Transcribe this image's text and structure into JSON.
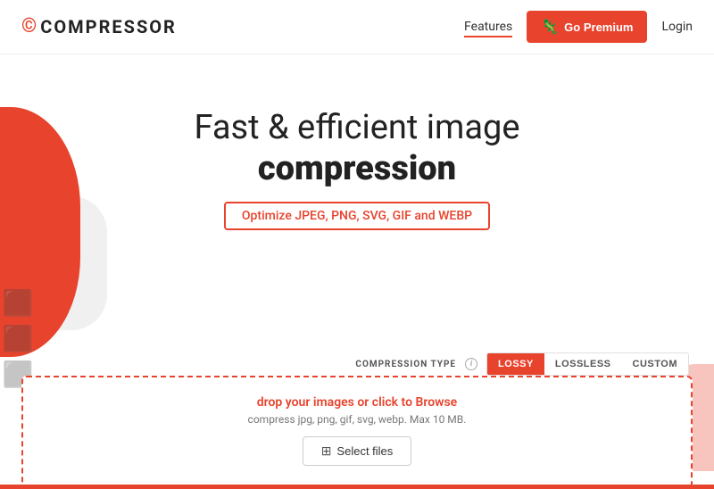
{
  "header": {
    "logo_icon": "©",
    "logo_text_before": "",
    "logo_text": "COMPRESSOR",
    "nav_features_label": "Features",
    "nav_premium_label": "Go Premium",
    "nav_login_label": "Login"
  },
  "hero": {
    "title_line1": "Fast & efficient image",
    "title_line2": "compression",
    "subtitle": "Optimize JPEG, PNG, SVG, GIF and WEBP"
  },
  "compression": {
    "label": "COMPRESSION TYPE",
    "info": "i",
    "tabs": [
      {
        "label": "LOSSY",
        "active": true
      },
      {
        "label": "LOSSLESS",
        "active": false
      },
      {
        "label": "CUSTOM",
        "active": false
      }
    ]
  },
  "dropzone": {
    "primary_text": "drop your images or click to Browse",
    "secondary_text": "compress jpg, png, gif, svg, webp. Max 10 MB.",
    "select_button_label": "Select files",
    "select_icon": "⊞"
  },
  "blob_icons": [
    "🖼",
    "📷",
    "🗂"
  ]
}
